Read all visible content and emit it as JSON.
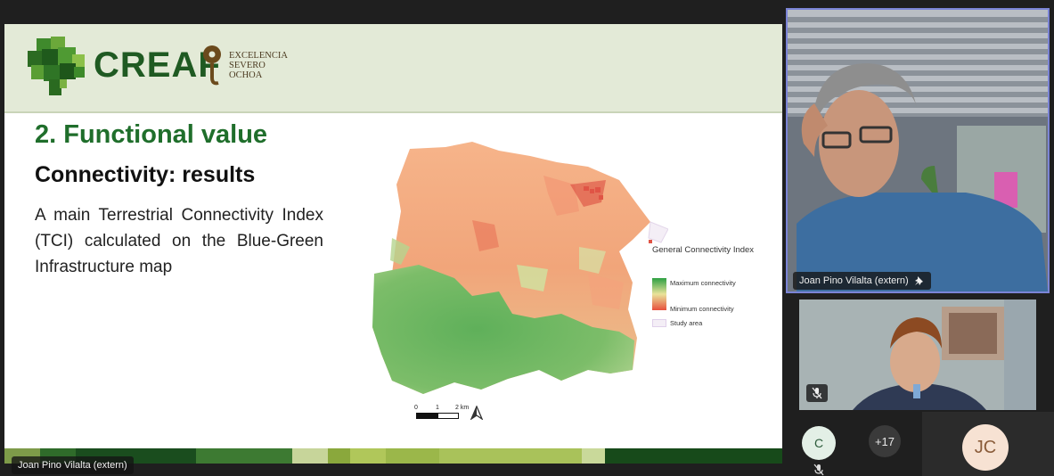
{
  "slide": {
    "logo_text": "CREAF",
    "severo_line1": "EXCELENCIA",
    "severo_line2": "SEVERO",
    "severo_line3": "OCHOA",
    "title": "2. Functional value",
    "subtitle": "Connectivity: results",
    "body": "A main Terrestrial Connectivity Index (TCI) calculated on the Blue-Green Infrastructure map",
    "legend": {
      "title": "General Connectivity Index",
      "max_label": "Maximum connectivity",
      "min_label": "Minimum connectivity",
      "study_area_label": "Study area"
    },
    "scale": {
      "tick0": "0",
      "tick1": "1",
      "tick2": "2 km"
    }
  },
  "presenter_label": "Joan Pino Vilalta (extern)",
  "participants": {
    "main_tile_name": "Joan Pino Vilalta (extern)",
    "c_initial": "C",
    "overflow_count": "+17",
    "jc_initials": "JC"
  },
  "colors": {
    "brand_green": "#1f6e2b",
    "active_speaker_border": "#7b84d6",
    "avatar_c_bg": "#e3efe6",
    "avatar_jc_bg": "#f7e2d3"
  }
}
